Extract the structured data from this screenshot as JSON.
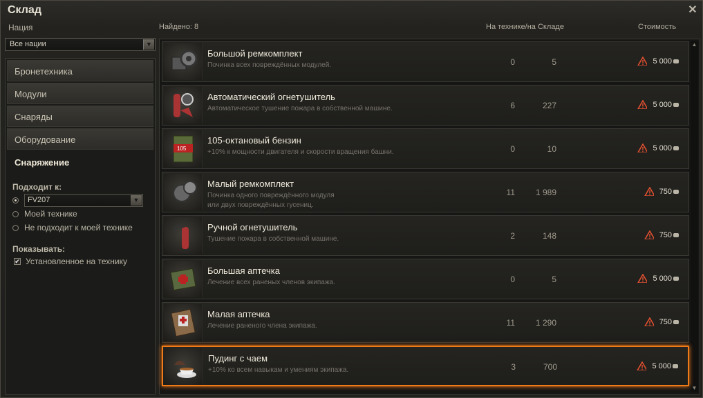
{
  "window": {
    "title": "Склад"
  },
  "filters": {
    "nation_label": "Нация",
    "nation_value": "Все нации",
    "categories": [
      "Бронетехника",
      "Модули",
      "Снаряды",
      "Оборудование",
      "Снаряжение"
    ],
    "active_category": "Снаряжение",
    "fits_label": "Подходит к:",
    "fits_vehicle": "FV207",
    "fits_options": [
      "Моей технике",
      "Не подходит к моей технике"
    ],
    "show_label": "Показывать:",
    "show_installed": "Установленное на технику"
  },
  "list": {
    "found": "Найдено: 8",
    "col_qty": "На технике/на Складе",
    "col_price": "Стоимость",
    "items": [
      {
        "name": "Большой ремкомплект",
        "desc": "Починка всех повреждённых модулей.",
        "on_vehicle": "0",
        "in_depot": "5",
        "price": "5 000",
        "icon": "repair-kit-large-icon"
      },
      {
        "name": "Автоматический огнетушитель",
        "desc": "Автоматическое тушение пожара в собственной машине.",
        "on_vehicle": "6",
        "in_depot": "227",
        "price": "5 000",
        "icon": "auto-extinguisher-icon"
      },
      {
        "name": "105-октановый бензин",
        "desc": "+10% к мощности двигателя и скорости вращения башни.",
        "on_vehicle": "0",
        "in_depot": "10",
        "price": "5 000",
        "icon": "gasoline-105-icon"
      },
      {
        "name": "Малый ремкомплект",
        "desc": "Починка одного повреждённого модуля",
        "desc2": "или двух повреждённых гусениц.",
        "on_vehicle": "11",
        "in_depot": "1 989",
        "price": "750",
        "icon": "repair-kit-small-icon"
      },
      {
        "name": "Ручной огнетушитель",
        "desc": "Тушение пожара в собственной машине.",
        "on_vehicle": "2",
        "in_depot": "148",
        "price": "750",
        "icon": "manual-extinguisher-icon"
      },
      {
        "name": "Большая аптечка",
        "desc": "Лечение всех раненых членов экипажа.",
        "on_vehicle": "0",
        "in_depot": "5",
        "price": "5 000",
        "icon": "first-aid-large-icon"
      },
      {
        "name": "Малая аптечка",
        "desc": "Лечение раненого члена экипажа.",
        "on_vehicle": "11",
        "in_depot": "1 290",
        "price": "750",
        "icon": "first-aid-small-icon"
      },
      {
        "name": "Пудинг с чаем",
        "desc": "+10% ко всем навыкам и умениям экипажа.",
        "on_vehicle": "3",
        "in_depot": "700",
        "price": "5 000",
        "icon": "pudding-tea-icon",
        "highlighted": true
      }
    ]
  },
  "colors": {
    "highlight": "#f07a18",
    "warning": "#e05030"
  }
}
